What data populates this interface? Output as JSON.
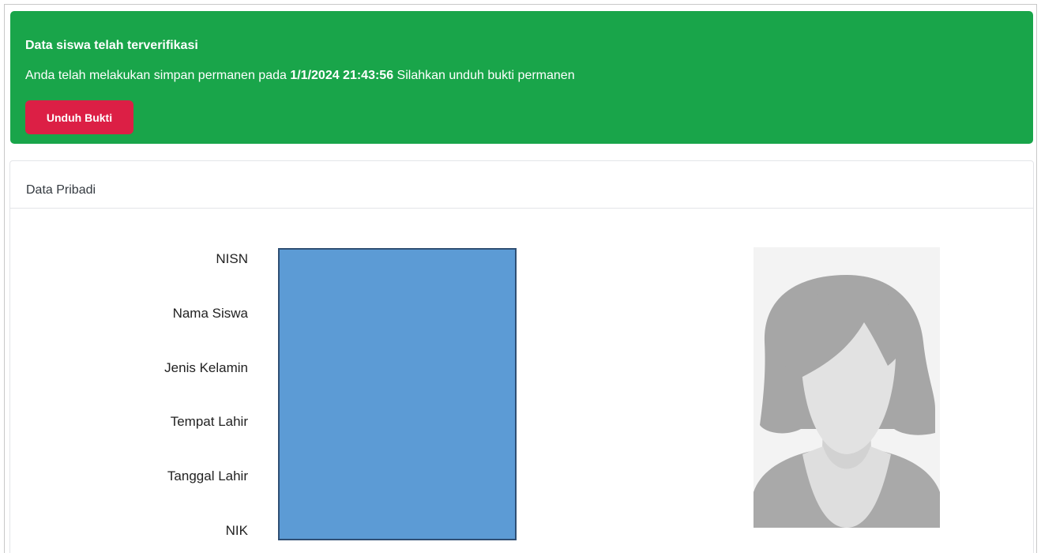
{
  "alert": {
    "title": "Data siswa telah terverifikasi",
    "text_before": "Anda telah melakukan simpan permanen pada ",
    "timestamp": "1/1/2024 21:43:56",
    "text_after": " Silahkan unduh bukti permanen",
    "button_label": "Unduh Bukti"
  },
  "card": {
    "header": "Data Pribadi",
    "fields": [
      "NISN",
      "Nama Siswa",
      "Jenis Kelamin",
      "Tempat Lahir",
      "Tanggal Lahir",
      "NIK"
    ]
  },
  "colors": {
    "alert_bg": "#19a54a",
    "button_bg": "#dc1f45",
    "redaction_fill": "#5c9bd5",
    "redaction_border": "#2f4f74"
  },
  "icons": {
    "avatar": "female-avatar-placeholder-icon"
  }
}
